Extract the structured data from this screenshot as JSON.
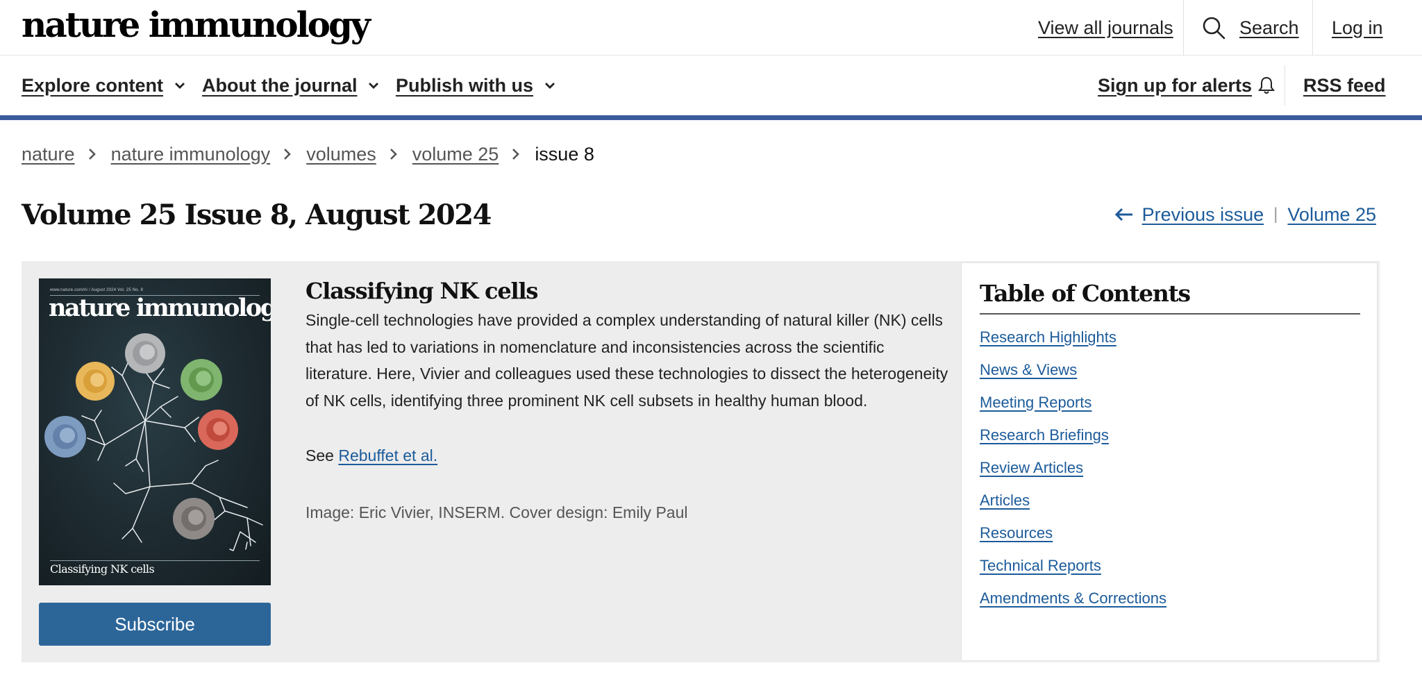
{
  "header": {
    "logo": "nature immunology",
    "view_all_journals": "View all journals",
    "search": "Search",
    "login": "Log in"
  },
  "nav": {
    "explore": "Explore content",
    "about": "About the journal",
    "publish": "Publish with us",
    "alerts": "Sign up for alerts",
    "rss": "RSS feed"
  },
  "breadcrumb": [
    "nature",
    "nature immunology",
    "volumes",
    "volume 25",
    "issue 8"
  ],
  "page": {
    "title": "Volume 25 Issue 8, August 2024",
    "previous_issue": "Previous issue",
    "volume_link": "Volume 25",
    "separator": "|"
  },
  "cover": {
    "small_line": "www.nature.com/ni / August 2024 Vol. 25 No. 8",
    "journal": "nature immunology",
    "caption": "Classifying NK cells"
  },
  "story": {
    "title": "Classifying NK cells",
    "body": "Single-cell technologies have provided a complex understanding of natural killer (NK) cells that has led to variations in nomenclature and inconsistencies across the scientific literature. Here, Vivier and colleagues used these technologies to dissect the heterogeneity of NK cells, identifying three prominent NK cell subsets in healthy human blood.",
    "see_prefix": "See",
    "see_link": "Rebuffet et al.",
    "credit": "Image: Eric Vivier, INSERM. Cover design: Emily Paul"
  },
  "subscribe": "Subscribe",
  "toc": {
    "title": "Table of Contents",
    "items": [
      "Research Highlights",
      "News & Views",
      "Meeting Reports",
      "Research Briefings",
      "Review Articles",
      "Articles",
      "Resources",
      "Technical Reports",
      "Amendments & Corrections"
    ]
  },
  "colors": {
    "accent_bar": "#3b5c9c",
    "link": "#1c5b9a",
    "subscribe_bg": "#2c6699",
    "panel_bg": "#ededed"
  }
}
